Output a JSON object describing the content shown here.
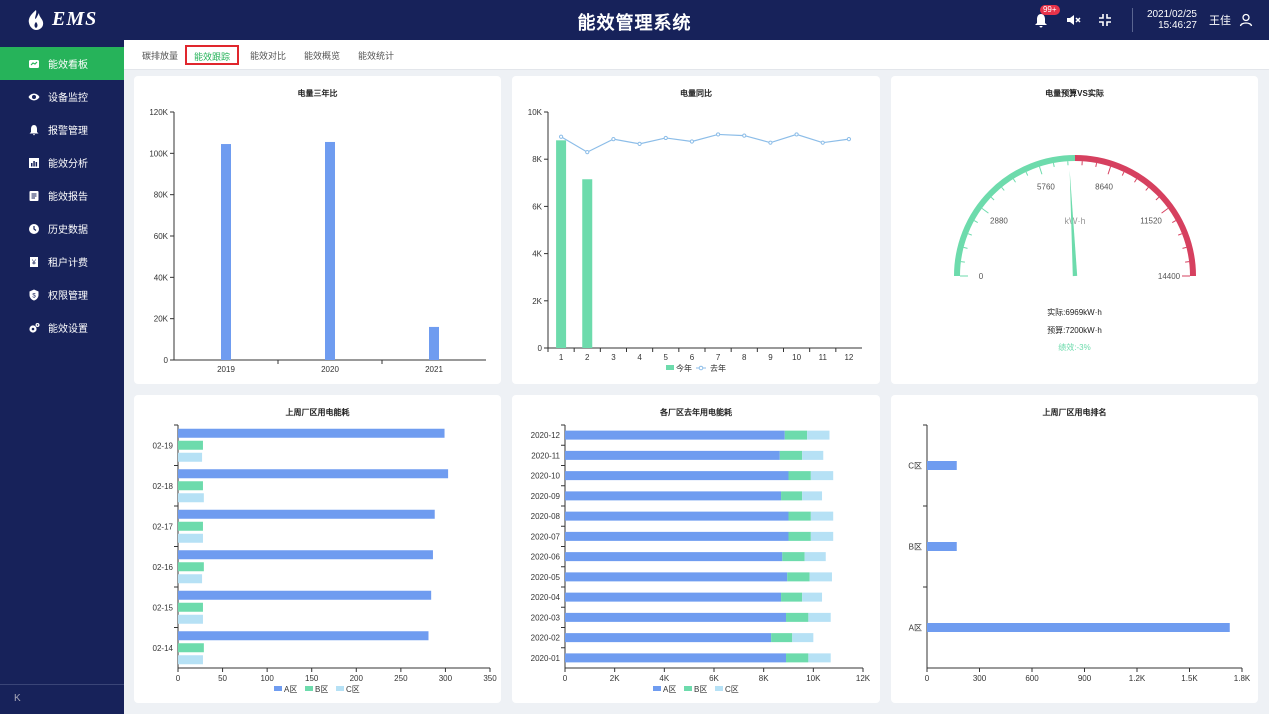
{
  "app": {
    "logo_text": "EMS",
    "title": "能效管理系统",
    "notifications": "99+",
    "date": "2021/02/25",
    "time": "15:46:27",
    "user": "王佳"
  },
  "sidebar": {
    "items": [
      {
        "label": "能效看板",
        "icon": "dashboard-icon",
        "active": true
      },
      {
        "label": "设备监控",
        "icon": "eye-icon"
      },
      {
        "label": "报警管理",
        "icon": "bell-icon"
      },
      {
        "label": "能效分析",
        "icon": "bar-chart-icon"
      },
      {
        "label": "能效报告",
        "icon": "report-icon"
      },
      {
        "label": "历史数据",
        "icon": "clock-icon"
      },
      {
        "label": "租户计费",
        "icon": "bill-icon"
      },
      {
        "label": "权限管理",
        "icon": "shield-icon"
      },
      {
        "label": "能效设置",
        "icon": "gear-icon"
      }
    ],
    "collapse_label": "K"
  },
  "tabs": [
    {
      "label": "碳排放量"
    },
    {
      "label": "能效跟踪",
      "active": true
    },
    {
      "label": "能效对比"
    },
    {
      "label": "能效概览"
    },
    {
      "label": "能效统计"
    }
  ],
  "colors": {
    "blue": "#6f9cf0",
    "green": "#6ddbac",
    "lightblue": "#b6e1f5",
    "red": "#d6405f",
    "active": "#26b35a"
  },
  "charts": {
    "yearly": {
      "title": "电量三年比"
    },
    "yoy": {
      "title": "电量同比",
      "legend_this": "今年",
      "legend_last": "去年"
    },
    "gauge": {
      "title": "电量预算VS实际",
      "unit": "kW·h",
      "actual": "实际:6969kW·h",
      "budget": "预算:7200kW·h",
      "perf": "绩效:-3%"
    },
    "weekly": {
      "title": "上周厂区用电能耗"
    },
    "monthly": {
      "title": "各厂区去年用电能耗"
    },
    "ranking": {
      "title": "上周厂区用电排名"
    }
  },
  "chart_data": [
    {
      "type": "bar",
      "title": "电量三年比",
      "categories": [
        "2019",
        "2020",
        "2021"
      ],
      "values": [
        104500,
        105500,
        16000
      ],
      "ylim": [
        0,
        120000
      ],
      "yticks": [
        "0",
        "20K",
        "40K",
        "60K",
        "80K",
        "100K",
        "120K"
      ]
    },
    {
      "type": "line",
      "title": "电量同比",
      "categories": [
        "1",
        "2",
        "3",
        "4",
        "5",
        "6",
        "7",
        "8",
        "9",
        "10",
        "11",
        "12"
      ],
      "series": [
        {
          "name": "今年",
          "kind": "bar",
          "values": [
            8800,
            7150
          ]
        },
        {
          "name": "去年",
          "kind": "line",
          "values": [
            8950,
            8300,
            8850,
            8650,
            8900,
            8750,
            9050,
            9000,
            8700,
            9050,
            8700,
            8850
          ]
        }
      ],
      "ylim": [
        0,
        10000
      ],
      "yticks": [
        "0",
        "2K",
        "4K",
        "6K",
        "8K",
        "10K"
      ]
    },
    {
      "type": "gauge",
      "title": "电量预算VS实际",
      "min": 0,
      "max": 14400,
      "value": 6969,
      "ticks": [
        "0",
        "2880",
        "5760",
        "8640",
        "11520",
        "14400"
      ],
      "split_value": 7200
    },
    {
      "type": "bar",
      "title": "上周厂区用电能耗",
      "orientation": "horizontal",
      "categories": [
        "02-14",
        "02-15",
        "02-16",
        "02-17",
        "02-18",
        "02-19"
      ],
      "series": [
        {
          "name": "A区",
          "values": [
            281,
            284,
            286,
            288,
            303,
            299
          ]
        },
        {
          "name": "B区",
          "values": [
            29,
            28,
            29,
            28,
            28,
            28
          ]
        },
        {
          "name": "C区",
          "values": [
            28,
            28,
            27,
            28,
            29,
            27
          ]
        }
      ],
      "xlim": [
        0,
        350
      ],
      "xticks": [
        "0",
        "50",
        "100",
        "150",
        "200",
        "250",
        "300",
        "350"
      ]
    },
    {
      "type": "bar",
      "title": "各厂区去年用电能耗",
      "orientation": "horizontal",
      "stacked": true,
      "categories": [
        "2020-01",
        "2020-02",
        "2020-03",
        "2020-04",
        "2020-05",
        "2020-06",
        "2020-07",
        "2020-08",
        "2020-09",
        "2020-10",
        "2020-11",
        "2020-12"
      ],
      "series": [
        {
          "name": "A区",
          "values": [
            8900,
            8300,
            8900,
            8700,
            8950,
            8750,
            9000,
            9000,
            8700,
            9000,
            8650,
            8850
          ]
        },
        {
          "name": "B区",
          "values": [
            900,
            850,
            900,
            850,
            900,
            900,
            900,
            900,
            850,
            900,
            900,
            900
          ]
        },
        {
          "name": "C区",
          "values": [
            900,
            850,
            900,
            800,
            900,
            850,
            900,
            900,
            800,
            900,
            850,
            900
          ]
        }
      ],
      "xlim": [
        0,
        12000
      ],
      "xticks": [
        "0",
        "2K",
        "4K",
        "6K",
        "8K",
        "10K",
        "12K"
      ]
    },
    {
      "type": "bar",
      "title": "上周厂区用电排名",
      "orientation": "horizontal",
      "categories": [
        "A区",
        "B区",
        "C区"
      ],
      "values": [
        1730,
        170,
        170
      ],
      "xlim": [
        0,
        1800
      ],
      "xticks": [
        "0",
        "300",
        "600",
        "900",
        "1.2K",
        "1.5K",
        "1.8K"
      ]
    }
  ]
}
